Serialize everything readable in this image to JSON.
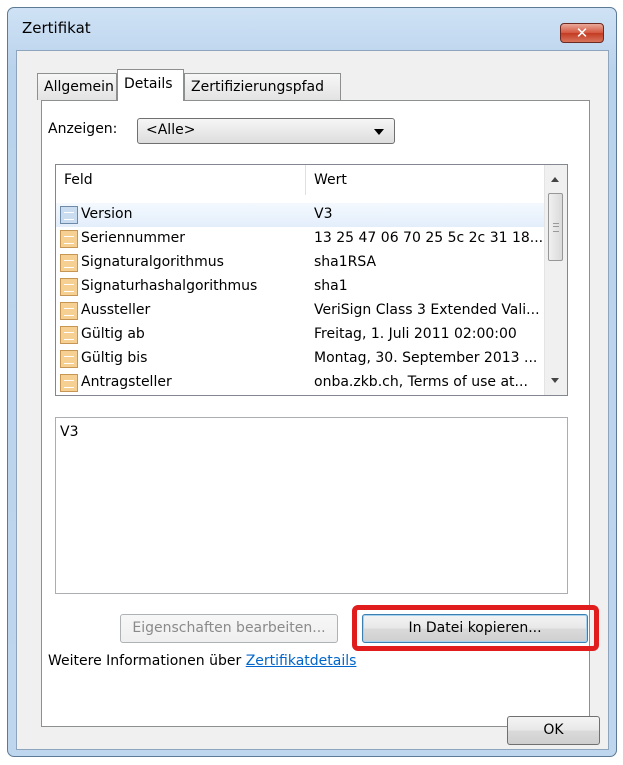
{
  "window": {
    "title": "Zertifikat",
    "close_glyph": "✕",
    "accent_color": "#c33b22"
  },
  "tabs": [
    {
      "label": "Allgemein",
      "active": false
    },
    {
      "label": "Details",
      "active": true
    },
    {
      "label": "Zertifizierungspfad",
      "active": false
    }
  ],
  "show": {
    "label": "Anzeigen:",
    "selected": "<Alle>"
  },
  "list": {
    "columns": [
      "Feld",
      "Wert"
    ],
    "rows": [
      {
        "field": "Version",
        "value": "V3",
        "icon": "certificate-field-icon"
      },
      {
        "field": "Seriennummer",
        "value": "13 25 47 06 70 25 5c 2c 31 18...",
        "icon": "certificate-field-icon"
      },
      {
        "field": "Signaturalgorithmus",
        "value": "sha1RSA",
        "icon": "certificate-field-icon"
      },
      {
        "field": "Signaturhashalgorithmus",
        "value": "sha1",
        "icon": "certificate-field-icon"
      },
      {
        "field": "Aussteller",
        "value": "VeriSign Class 3 Extended Vali...",
        "icon": "certificate-field-icon"
      },
      {
        "field": "Gültig ab",
        "value": "Freitag, 1. Juli 2011 02:00:00",
        "icon": "certificate-field-icon"
      },
      {
        "field": "Gültig bis",
        "value": "Montag, 30. September 2013 ...",
        "icon": "certificate-field-icon"
      },
      {
        "field": "Antragsteller",
        "value": "onba.zkb.ch, Terms of use at...",
        "icon": "certificate-field-icon"
      }
    ],
    "selected_index": 0
  },
  "detail_value": "V3",
  "buttons": {
    "edit_properties": "Eigenschaften bearbeiten...",
    "copy_to_file": "In Datei kopieren...",
    "ok": "OK"
  },
  "highlight_color": "#e01c1c",
  "info": {
    "text": "Weitere Informationen über ",
    "link": "Zertifikatdetails",
    "link_color": "#0066cc"
  }
}
